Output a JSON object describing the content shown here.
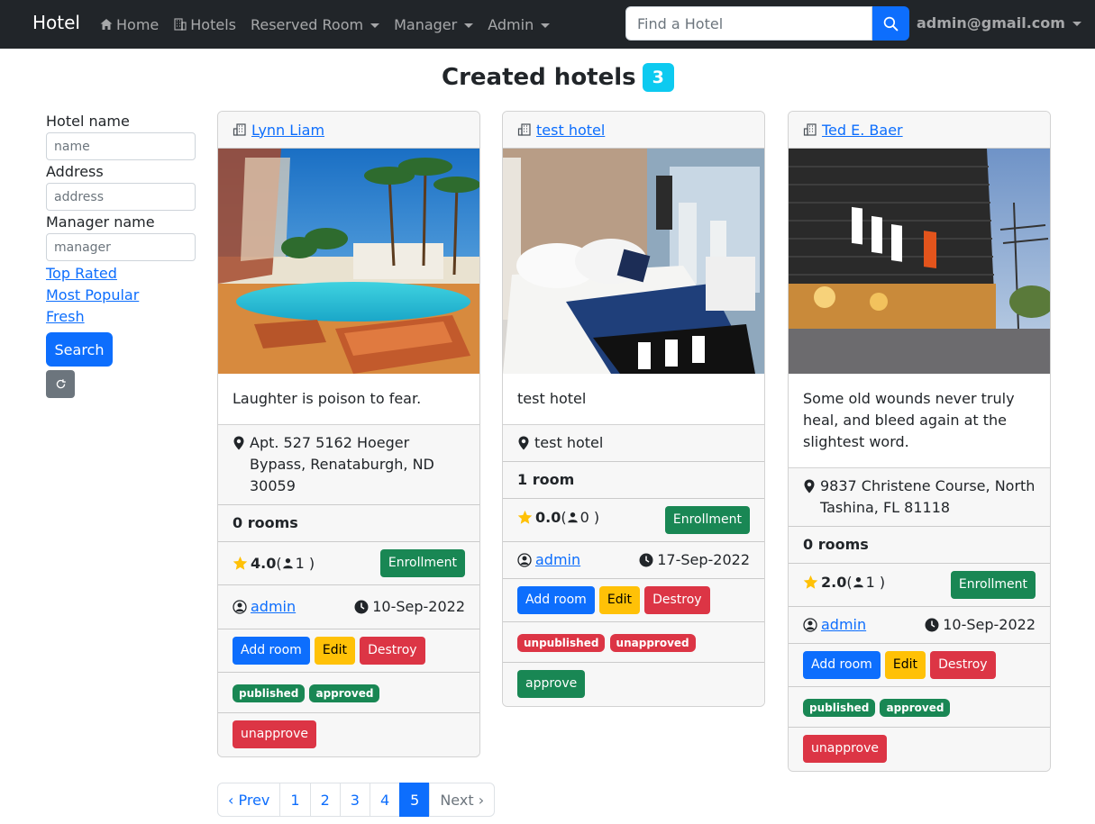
{
  "navbar": {
    "brand": "Hotel",
    "home": "Home",
    "hotels": "Hotels",
    "reserved": "Reserved Room",
    "manager": "Manager",
    "admin": "Admin",
    "search_placeholder": "Find a Hotel",
    "user": "admin@gmail.com"
  },
  "heading": {
    "title": "Created hotels",
    "count": "3"
  },
  "sidebar": {
    "hotel_name_label": "Hotel name",
    "hotel_name_placeholder": "name",
    "address_label": "Address",
    "address_placeholder": "address",
    "manager_label": "Manager name",
    "manager_placeholder": "manager",
    "links": [
      "Top Rated",
      "Most Popular",
      "Fresh"
    ],
    "search_label": "Search"
  },
  "cards": [
    {
      "name": "Lynn Liam",
      "image": "pool-resort-photo",
      "description": "Laughter is poison to fear.",
      "address": "Apt. 527 5162 Hoeger Bypass, Renataburgh, ND 30059",
      "rooms": "0 rooms",
      "rating": "4.0",
      "reviews": "1",
      "enroll_label": "Enrollment",
      "owner": "admin",
      "date": "10-Sep-2022",
      "add_room": "Add room",
      "edit": "Edit",
      "destroy": "Destroy",
      "badges": [
        "published",
        "approved"
      ],
      "action": "unapprove"
    },
    {
      "name": "test hotel",
      "image": "hotel-bedroom-photo",
      "description": "test hotel",
      "address": "test hotel",
      "rooms": "1 room",
      "rating": "0.0",
      "reviews": "0",
      "enroll_label": "Enrollment",
      "owner": "admin",
      "date": "17-Sep-2022",
      "add_room": "Add room",
      "edit": "Edit",
      "destroy": "Destroy",
      "badges": [
        "unpublished",
        "unapproved"
      ],
      "action": "approve"
    },
    {
      "name": "Ted E. Baer",
      "image": "hotel-facade-night-photo",
      "description": "Some old wounds never truly heal, and bleed again at the slightest word.",
      "address": "9837 Christene Course, North Tashina, FL 81118",
      "rooms": "0 rooms",
      "rating": "2.0",
      "reviews": "1",
      "enroll_label": "Enrollment",
      "owner": "admin",
      "date": "10-Sep-2022",
      "add_room": "Add room",
      "edit": "Edit",
      "destroy": "Destroy",
      "badges": [
        "published",
        "approved"
      ],
      "action": "unapprove"
    }
  ],
  "pagination": {
    "prev": "‹ Prev",
    "pages": [
      "1",
      "2",
      "3",
      "4",
      "5"
    ],
    "next": "Next ›",
    "current": "5"
  }
}
